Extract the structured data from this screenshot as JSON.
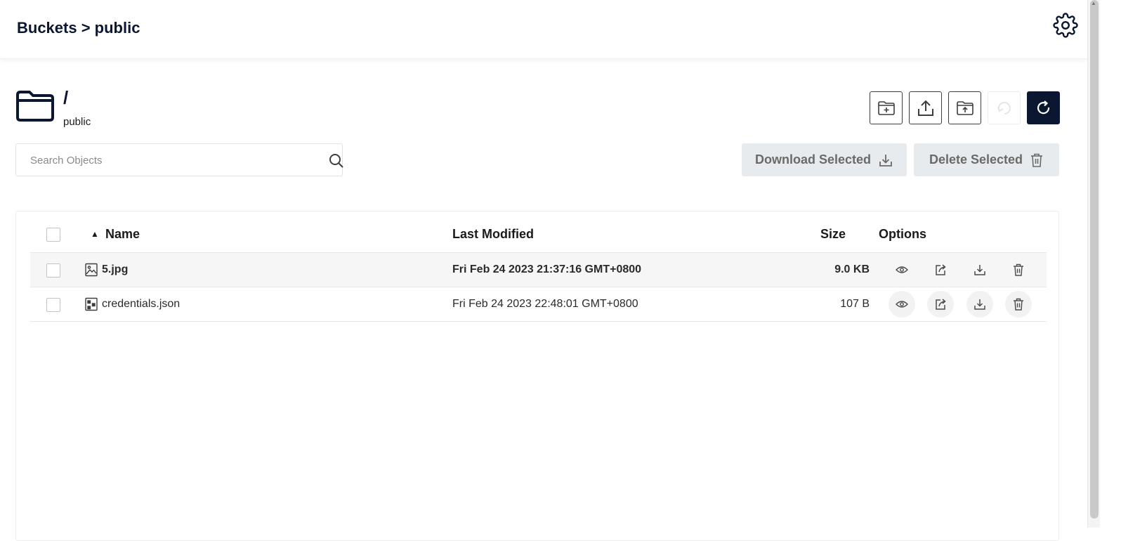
{
  "header": {
    "breadcrumb": "Buckets > public",
    "settings_icon": "gear-icon"
  },
  "path": {
    "current": "/",
    "bucket": "public",
    "icon": "folder-icon"
  },
  "toolbar": {
    "buttons": [
      {
        "name": "create-folder",
        "icon": "folder-plus-icon"
      },
      {
        "name": "upload-file",
        "icon": "upload-icon"
      },
      {
        "name": "upload-folder",
        "icon": "folder-upload-icon"
      },
      {
        "name": "rewind",
        "icon": "rewind-icon",
        "disabled": true
      },
      {
        "name": "refresh",
        "icon": "refresh-icon",
        "primary": true
      }
    ]
  },
  "search": {
    "placeholder": "Search Objects",
    "value": ""
  },
  "actions": {
    "download_label": "Download Selected",
    "delete_label": "Delete Selected"
  },
  "table": {
    "columns": {
      "name": "Name",
      "modified": "Last Modified",
      "size": "Size",
      "options": "Options"
    },
    "sort": {
      "column": "name",
      "direction": "asc"
    },
    "rows": [
      {
        "name": "5.jpg",
        "modified": "Fri Feb 24 2023 21:37:16 GMT+0800",
        "size": "9.0 KB",
        "type_icon": "image-file-icon"
      },
      {
        "name": "credentials.json",
        "modified": "Fri Feb 24 2023 22:48:01 GMT+0800",
        "size": "107 B",
        "type_icon": "json-file-icon"
      }
    ]
  },
  "colors": {
    "primary": "#0b1730",
    "action_bg": "#e8ebed",
    "action_text": "#6a6a6a"
  }
}
